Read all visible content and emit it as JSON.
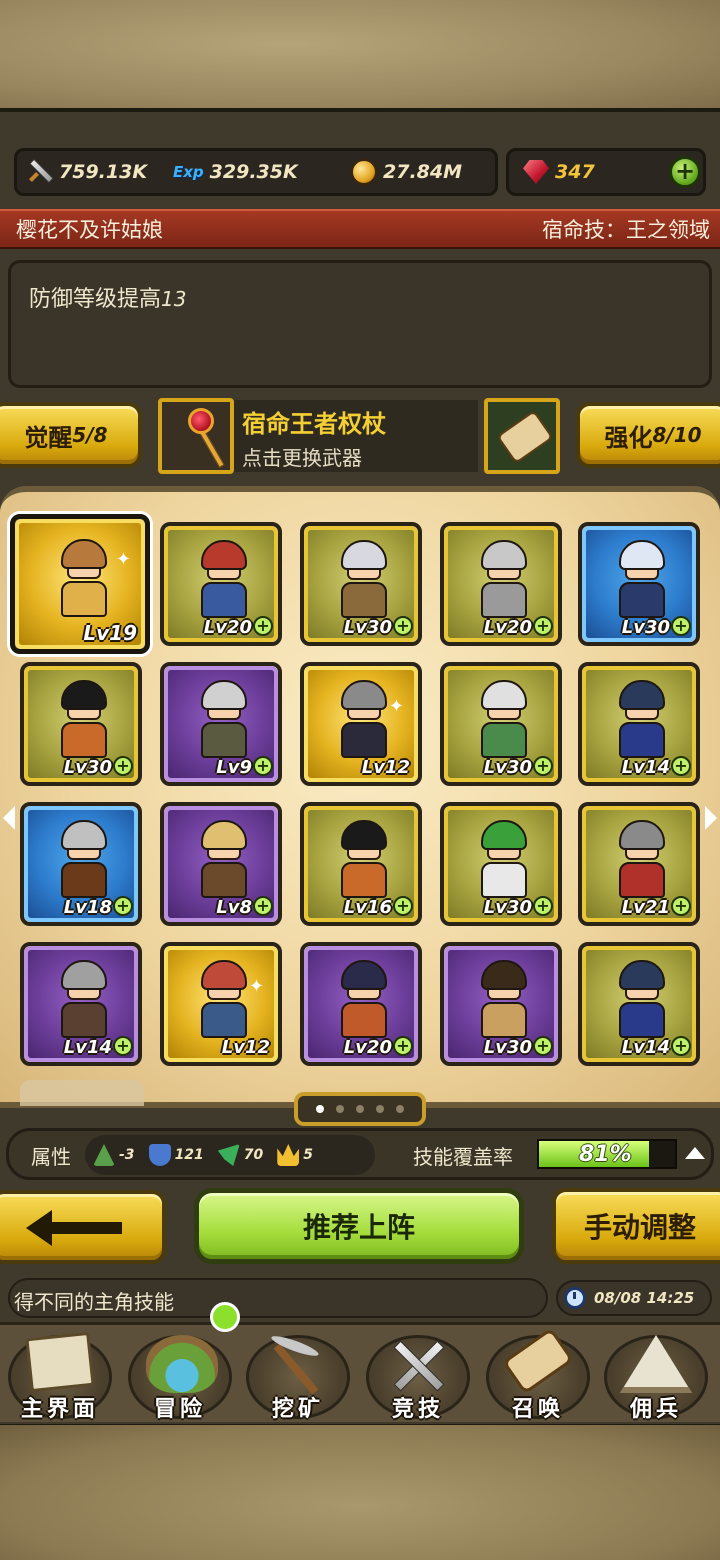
{
  "resources": {
    "attack": {
      "icon": "sword-icon",
      "value": "759.13K"
    },
    "exp": {
      "icon": "exp-icon",
      "label": "Exp",
      "value": "329.35K"
    },
    "gold": {
      "icon": "coin-icon",
      "value": "27.84M"
    },
    "gems": {
      "icon": "gem-icon",
      "value": "347"
    },
    "add_label": "+"
  },
  "hero": {
    "name": "樱花不及许姑娘",
    "fate_skill": "宿命技：王之领域",
    "description": "防御等级提高",
    "description_value": "13"
  },
  "awaken": {
    "label": "觉醒",
    "value": "5/8"
  },
  "weapon": {
    "name": "宿命王者权杖",
    "hint": "点击更换武器"
  },
  "enhance": {
    "label": "强化",
    "value": "8/10"
  },
  "heroes": [
    {
      "lv": "Lv19",
      "rarity": "gold",
      "hair": "#b87a3c",
      "cloth": "#e0b04a",
      "selected": true,
      "plus": false
    },
    {
      "lv": "Lv20",
      "rarity": "green",
      "hair": "#b83a2c",
      "cloth": "#3a5aa0",
      "plus": true
    },
    {
      "lv": "Lv30",
      "rarity": "green",
      "hair": "#d8d8e0",
      "cloth": "#8a6a3a",
      "plus": true
    },
    {
      "lv": "Lv20",
      "rarity": "green",
      "hair": "#c8c8c8",
      "cloth": "#9a9a9a",
      "plus": true
    },
    {
      "lv": "Lv30",
      "rarity": "blue",
      "hair": "#dfe6f4",
      "cloth": "#2a3a6a",
      "plus": true
    },
    {
      "lv": "Lv30",
      "rarity": "green",
      "hair": "#1a1a1a",
      "cloth": "#c96a2a",
      "plus": true
    },
    {
      "lv": "Lv9",
      "rarity": "purple",
      "hair": "#d0d0d0",
      "cloth": "#5a5a40",
      "plus": true
    },
    {
      "lv": "Lv12",
      "rarity": "gold",
      "hair": "#8a8a8a",
      "cloth": "#2a2a3a",
      "plus": false
    },
    {
      "lv": "Lv30",
      "rarity": "green",
      "hair": "#e0e0e0",
      "cloth": "#4a8a4a",
      "plus": true
    },
    {
      "lv": "Lv14",
      "rarity": "green",
      "hair": "#2a3a5a",
      "cloth": "#2a3a8a",
      "plus": true
    },
    {
      "lv": "Lv18",
      "rarity": "blue",
      "hair": "#c0c0c0",
      "cloth": "#6a3a1a",
      "plus": true
    },
    {
      "lv": "Lv8",
      "rarity": "purple",
      "hair": "#e0c070",
      "cloth": "#6a4a2a",
      "plus": true
    },
    {
      "lv": "Lv16",
      "rarity": "green",
      "hair": "#1a1a1a",
      "cloth": "#c96a2a",
      "plus": true
    },
    {
      "lv": "Lv30",
      "rarity": "green",
      "hair": "#3aa03a",
      "cloth": "#e8e8e8",
      "plus": true
    },
    {
      "lv": "Lv21",
      "rarity": "green",
      "hair": "#8a8a8a",
      "cloth": "#b0302a",
      "plus": true
    },
    {
      "lv": "Lv14",
      "rarity": "purple",
      "hair": "#a0a0a0",
      "cloth": "#5a4030",
      "plus": true
    },
    {
      "lv": "Lv12",
      "rarity": "gold",
      "hair": "#c04a3a",
      "cloth": "#3a5a8a",
      "plus": false
    },
    {
      "lv": "Lv20",
      "rarity": "purple",
      "hair": "#2a2a4a",
      "cloth": "#c05a2a",
      "plus": true
    },
    {
      "lv": "Lv30",
      "rarity": "purple",
      "hair": "#3a2a1a",
      "cloth": "#c9a060",
      "plus": true
    },
    {
      "lv": "Lv14",
      "rarity": "green",
      "hair": "#2a3a5a",
      "cloth": "#2a3a8a",
      "plus": true
    }
  ],
  "pager": {
    "pages": 5,
    "current": 0
  },
  "attributes": {
    "label": "属性",
    "items": [
      {
        "icon": "nature-icon",
        "value": "-3"
      },
      {
        "icon": "shield-icon",
        "value": "121"
      },
      {
        "icon": "wing-icon",
        "value": "70"
      },
      {
        "icon": "crown-icon",
        "value": "5"
      }
    ],
    "coverage_label": "技能覆盖率",
    "coverage_value": "81%",
    "coverage_fraction": 0.81
  },
  "actions": {
    "recommend": "推荐上阵",
    "manual": "手动调整"
  },
  "message": "得不同的主角技能",
  "time": "08/08 14:25",
  "nav": [
    {
      "label": "主界面",
      "icon": "map-scroll-icon"
    },
    {
      "label": "冒险",
      "icon": "island-icon"
    },
    {
      "label": "挖矿",
      "icon": "pickaxe-icon"
    },
    {
      "label": "竞技",
      "icon": "crossed-swords-icon"
    },
    {
      "label": "召唤",
      "icon": "scroll-icon"
    },
    {
      "label": "佣兵",
      "icon": "tent-icon"
    }
  ]
}
